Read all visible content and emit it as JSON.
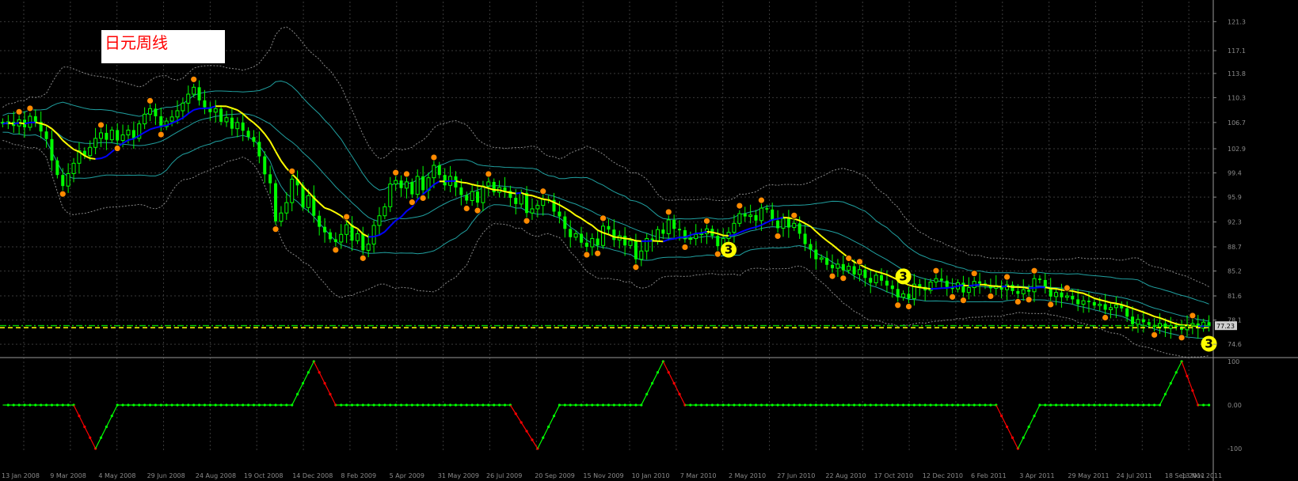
{
  "window": {
    "title": "日元周线"
  },
  "colors": {
    "background": "#000000",
    "grid": "#3a3a3a",
    "bull": "#00ff00",
    "bear": "#00ff00",
    "ma_up": "#ffff00",
    "ma_down": "#0000ff",
    "bands": "#20a0a0",
    "outer_bands": "#8a8a8a",
    "level_line": "#00cc00",
    "level_line_alt": "#ffff00",
    "osc_up": "#00ff00",
    "osc_down": "#ff0000",
    "marker_top": "#ff44cc",
    "marker_small": "#ff8a00",
    "wave_label": "#ffff00"
  },
  "chart_data": [
    {
      "type": "candlestick",
      "name": "main",
      "price_axis_ticks": [
        "121.3",
        "117.1",
        "113.8",
        "110.3",
        "106.7",
        "102.9",
        "99.4",
        "95.9",
        "92.3",
        "88.7",
        "85.2",
        "81.6",
        "78.1",
        "74.6"
      ],
      "ylim": [
        72.9,
        124.2
      ],
      "time_axis_labels": [
        "13 Jan 2008",
        "9 Mar 2008",
        "4 May 2008",
        "29 Jun 2008",
        "24 Aug 2008",
        "19 Oct 2008",
        "14 Dec 2008",
        "8 Feb 2009",
        "5 Apr 2009",
        "31 May 2009",
        "26 Jul 2009",
        "20 Sep 2009",
        "15 Nov 2009",
        "10 Jan 2010",
        "7 Mar 2010",
        "2 May 2010",
        "27 Jun 2010",
        "22 Aug 2010",
        "17 Oct 2010",
        "12 Dec 2010",
        "6 Feb 2011",
        "3 Apr 2011",
        "29 May 2011",
        "24 Jul 2011",
        "18 Sep 2011",
        "13 Nov 2011"
      ],
      "current_price": "77.23",
      "level_lines": [
        77.3,
        77.0
      ],
      "closes": [
        106.5,
        106.8,
        106.2,
        107.1,
        106.0,
        107.6,
        106.8,
        105.4,
        104.3,
        101.2,
        99.1,
        97.5,
        99.3,
        100.8,
        102.6,
        101.9,
        103.1,
        104.4,
        105.2,
        104.2,
        105.6,
        104.1,
        104.9,
        105.6,
        104.4,
        106.5,
        107.9,
        108.7,
        107.6,
        106.1,
        106.9,
        107.5,
        108.4,
        109.5,
        110.8,
        111.8,
        109.9,
        108.9,
        108.2,
        108.7,
        106.8,
        107.4,
        105.8,
        106.7,
        105.5,
        104.6,
        103.9,
        101.8,
        99.2,
        97.9,
        92.4,
        93.6,
        95.1,
        98.5,
        97.6,
        94.4,
        96.1,
        93.2,
        91.6,
        90.8,
        89.8,
        89.4,
        90.5,
        91.9,
        89.6,
        90.6,
        88.2,
        89.1,
        91.8,
        93.2,
        94.5,
        97.8,
        98.3,
        97.2,
        98.1,
        96.3,
        98.9,
        96.9,
        98.7,
        100.5,
        99.1,
        97.6,
        98.9,
        97.3,
        96.2,
        95.4,
        96.7,
        95.1,
        97.5,
        98.1,
        96.6,
        97.3,
        96.8,
        95.8,
        94.9,
        96.5,
        93.6,
        94.2,
        94.7,
        95.6,
        95.5,
        93.8,
        93.1,
        91.3,
        90.1,
        90.6,
        89.3,
        88.7,
        89.9,
        88.9,
        91.7,
        91.2,
        89.7,
        90.3,
        88.9,
        89.6,
        86.9,
        88.1,
        89.9,
        89.5,
        91.2,
        90.6,
        92.6,
        91.3,
        91.1,
        89.8,
        89.9,
        90.5,
        90.6,
        91.3,
        90.3,
        88.8,
        89.9,
        90.8,
        92.1,
        93.5,
        93.1,
        93.3,
        92.5,
        94.3,
        94.1,
        92.5,
        91.4,
        92.8,
        91.5,
        92.1,
        90.6,
        89.1,
        88.3,
        86.9,
        87.1,
        86.1,
        85.6,
        86.2,
        85.3,
        85.9,
        84.7,
        85.4,
        84.2,
        83.5,
        84.6,
        83.8,
        83.1,
        82.6,
        81.4,
        81.9,
        81.2,
        83.3,
        82.9,
        82.4,
        83.6,
        84.1,
        83.8,
        82.9,
        82.6,
        83.5,
        82.1,
        82.8,
        83.7,
        83.4,
        83.1,
        82.7,
        83.1,
        82.5,
        83.2,
        82.3,
        81.9,
        82.5,
        82.2,
        84.1,
        83.9,
        82.7,
        81.5,
        82.1,
        81.4,
        81.6,
        81.1,
        80.4,
        80.9,
        80.7,
        80.2,
        80.4,
        79.6,
        79.9,
        80.3,
        79.8,
        78.6,
        77.5,
        78.2,
        77.8,
        77.4,
        77.1,
        77.6,
        76.9,
        77.3,
        77.1,
        76.7,
        77.3,
        77.6,
        76.9,
        77.8,
        77.2
      ]
    },
    {
      "type": "line",
      "name": "oscillator",
      "ylim": [
        -100,
        100
      ],
      "axis_ticks": [
        "100",
        "0.00",
        "-100"
      ],
      "cycle_pivots": [
        {
          "i": 0,
          "v": 0
        },
        {
          "i": 13,
          "v": 0
        },
        {
          "i": 17,
          "v": -100
        },
        {
          "i": 21,
          "v": 0
        },
        {
          "i": 53,
          "v": 0
        },
        {
          "i": 57,
          "v": 100
        },
        {
          "i": 61,
          "v": 0
        },
        {
          "i": 93,
          "v": 0
        },
        {
          "i": 98,
          "v": -100
        },
        {
          "i": 102,
          "v": 0
        },
        {
          "i": 117,
          "v": 0
        },
        {
          "i": 121,
          "v": 100
        },
        {
          "i": 125,
          "v": 0
        },
        {
          "i": 182,
          "v": 0
        },
        {
          "i": 186,
          "v": -100
        },
        {
          "i": 190,
          "v": 0
        },
        {
          "i": 212,
          "v": 0
        },
        {
          "i": 216,
          "v": 100
        },
        {
          "i": 219,
          "v": 0
        },
        {
          "i": 230,
          "v": 0
        }
      ]
    }
  ],
  "wave_labels": [
    {
      "text": "3",
      "candle_index": 133,
      "pos": "below"
    },
    {
      "text": "3",
      "candle_index": 165,
      "pos": "above"
    },
    {
      "text": "3",
      "candle_index": 272,
      "pos": "below"
    }
  ]
}
